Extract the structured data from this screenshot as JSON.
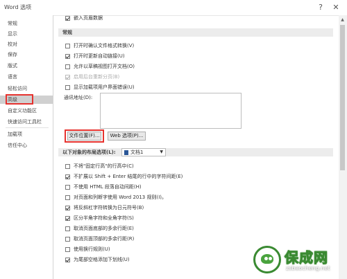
{
  "window": {
    "title": "Word 选项",
    "help_glyph": "?",
    "close_glyph": "✕"
  },
  "sidebar": {
    "items": [
      {
        "label": "常规"
      },
      {
        "label": "显示"
      },
      {
        "label": "校对"
      },
      {
        "label": "保存"
      },
      {
        "label": "版式"
      },
      {
        "label": "语言"
      },
      {
        "label": "轻松访问"
      },
      {
        "label": "高级"
      },
      {
        "label": "自定义功能区"
      },
      {
        "label": "快速访问工具栏"
      },
      {
        "label": "加载项"
      },
      {
        "label": "信任中心"
      }
    ],
    "selected": "高级"
  },
  "main": {
    "top_row": {
      "label": "嵌入页眉数据",
      "checked": true
    },
    "general": {
      "header": "常规",
      "options": [
        {
          "label": "打开时确认文件格式转换(V)",
          "checked": false,
          "disabled": false
        },
        {
          "label": "打开时更新自动链接(U)",
          "checked": true,
          "disabled": false
        },
        {
          "label": "允许以草稿视图打开文档(O)",
          "checked": false,
          "disabled": false
        },
        {
          "label": "启用后台重新分页(B)",
          "checked": true,
          "disabled": true
        },
        {
          "label": "显示加载项用户界面错误(U)",
          "checked": false,
          "disabled": false
        }
      ],
      "mailing_address_label": "通讯地址(D):",
      "mailing_address_value": "",
      "file_locations_button": "文件位置(F)...",
      "web_options_button": "Web 选项(P)..."
    },
    "layout": {
      "header": "以下对象的布局选项(L):",
      "document_select": "文档1",
      "options": [
        {
          "label": "不将\"固定行高\"的行高中(C)",
          "checked": false
        },
        {
          "label": "不扩展以 Shift + Enter 结尾的行中的字符间距(E)",
          "checked": true
        },
        {
          "label": "不使用 HTML 段落自动间距(H)",
          "checked": false
        },
        {
          "label": "对页面和列断字使用 Word 2013 规则(I)。",
          "checked": false
        },
        {
          "label": "将反斜杠字符转换为日元符号(B)",
          "checked": true
        },
        {
          "label": "区分半角字符和全角字符(S)",
          "checked": true
        },
        {
          "label": "取消页面底部的多余行距(E)",
          "checked": false
        },
        {
          "label": "取消页面顶部的多余行距(R)",
          "checked": false
        },
        {
          "label": "使用换行规则(U)",
          "checked": false
        },
        {
          "label": "为尾部空格添加下划线(U)",
          "checked": true
        }
      ]
    }
  },
  "watermark": {
    "brand": "保成网",
    "url": "zsbaocheng.net"
  },
  "colors": {
    "highlight_red": "#e6322e",
    "selected_bg": "#d0d0d0",
    "section_bg": "#ececec"
  }
}
